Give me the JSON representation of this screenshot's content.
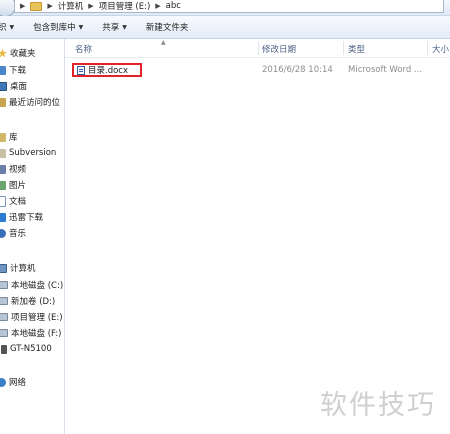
{
  "address_bar": {
    "crumbs": [
      "计算机",
      "项目管理 (E:)",
      "abc"
    ]
  },
  "toolbar": {
    "organize": "织",
    "include_in_library": "包含到库中",
    "share": "共享",
    "new_folder": "新建文件夹"
  },
  "nav": {
    "favorites": "收藏夹",
    "downloads": "下载",
    "desktop": "桌面",
    "recent": "最近访问的位",
    "libraries": "库",
    "subversion": "Subversion",
    "videos": "视频",
    "pictures": "图片",
    "documents": "文档",
    "xunlei": "迅雷下载",
    "music": "音乐",
    "computer": "计算机",
    "drive_c": "本地磁盘 (C:)",
    "drive_d": "新加卷 (D:)",
    "drive_e": "项目管理 (E:)",
    "drive_f": "本地磁盘 (F:)",
    "device": "GT-N5100",
    "network": "网络"
  },
  "columns": {
    "name": "名称",
    "date": "修改日期",
    "type": "类型",
    "size": "大小"
  },
  "files": [
    {
      "name": "目录.docx",
      "date": "2016/6/28 10:14",
      "type": "Microsoft Word ..."
    }
  ],
  "watermark": "软件技巧"
}
